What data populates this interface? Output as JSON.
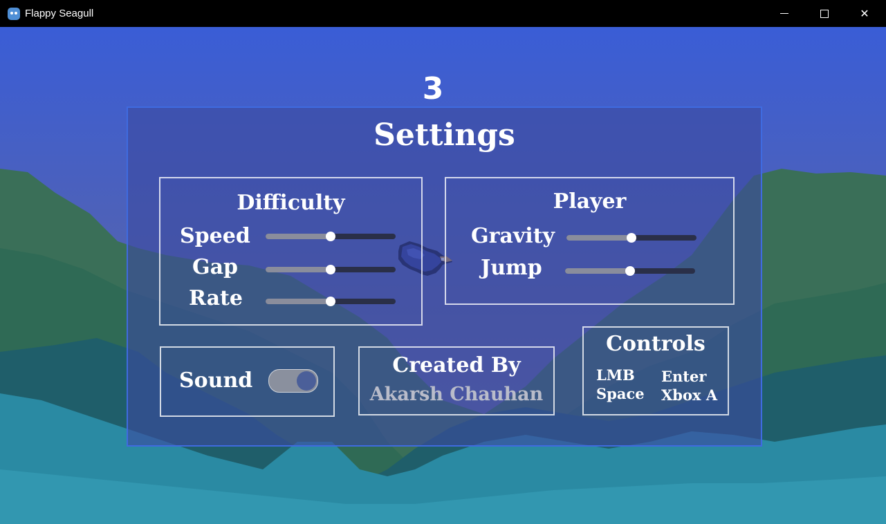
{
  "window": {
    "title": "Flappy Seagull",
    "icon": "godot-icon"
  },
  "hud": {
    "score": "3"
  },
  "settings": {
    "title": "Settings",
    "difficulty": {
      "title": "Difficulty",
      "sliders": [
        {
          "label": "Speed",
          "value": 0.5
        },
        {
          "label": "Gap",
          "value": 0.5
        },
        {
          "label": "Rate",
          "value": 0.5
        }
      ]
    },
    "player": {
      "title": "Player",
      "sliders": [
        {
          "label": "Gravity",
          "value": 0.5
        },
        {
          "label": "Jump",
          "value": 0.5
        }
      ]
    },
    "sound": {
      "label": "Sound",
      "enabled": true
    },
    "credits": {
      "title": "Created By",
      "name": "Akarsh Chauhan"
    },
    "controls": {
      "title": "Controls",
      "mouse_keys": "LMB",
      "space_key": "Space",
      "enter_key": "Enter",
      "gamepad_key": "Xbox A"
    }
  },
  "colors": {
    "panel_border": "#3f6be0",
    "sky_top": "#3a5dd6",
    "slider_fill": "#8a8d9c",
    "slider_track": "#2a2f48"
  }
}
